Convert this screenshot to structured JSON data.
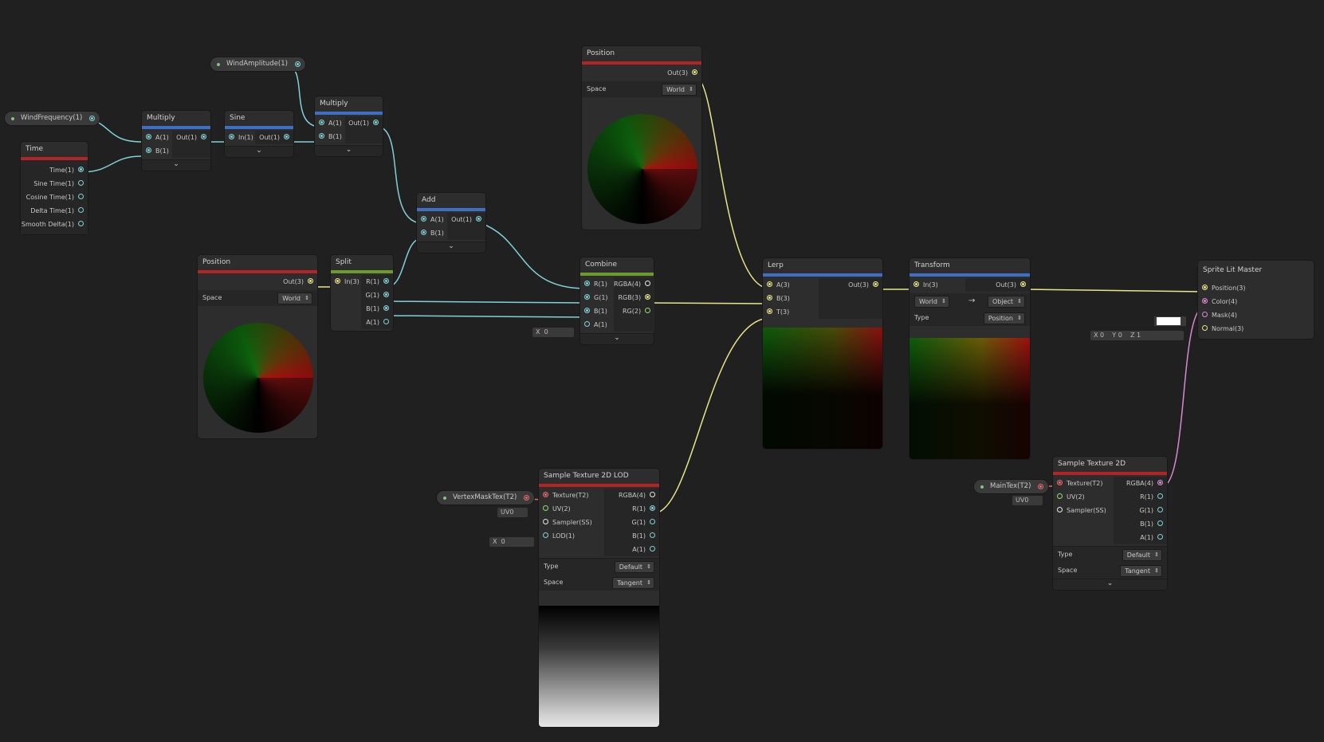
{
  "props": {
    "wind_frequency": "WindFrequency(1)",
    "wind_amplitude": "WindAmplitude(1)",
    "vertex_mask_tex": "VertexMaskTex(T2)",
    "main_tex": "MainTex(T2)"
  },
  "time": {
    "title": "Time",
    "outs": [
      "Time(1)",
      "Sine Time(1)",
      "Cosine Time(1)",
      "Delta Time(1)",
      "Smooth Delta(1)"
    ]
  },
  "multiply1": {
    "title": "Multiply",
    "in_a": "A(1)",
    "in_b": "B(1)",
    "out": "Out(1)"
  },
  "sine": {
    "title": "Sine",
    "in": "In(1)",
    "out": "Out(1)"
  },
  "multiply2": {
    "title": "Multiply",
    "in_a": "A(1)",
    "in_b": "B(1)",
    "out": "Out(1)"
  },
  "add": {
    "title": "Add",
    "in_a": "A(1)",
    "in_b": "B(1)",
    "out": "Out(1)"
  },
  "position_top": {
    "title": "Position",
    "out": "Out(3)",
    "space_label": "Space",
    "space_value": "World"
  },
  "position_left": {
    "title": "Position",
    "out": "Out(3)",
    "space_label": "Space",
    "space_value": "World"
  },
  "split": {
    "title": "Split",
    "in": "In(3)",
    "outs": [
      "R(1)",
      "G(1)",
      "B(1)",
      "A(1)"
    ]
  },
  "combine": {
    "title": "Combine",
    "ins": [
      "R(1)",
      "G(1)",
      "B(1)",
      "A(1)"
    ],
    "outs": [
      "RGBA(4)",
      "RGB(3)",
      "RG(2)"
    ],
    "a_default_label": "X",
    "a_default_value": "0"
  },
  "lerp": {
    "title": "Lerp",
    "ins": [
      "A(3)",
      "B(3)",
      "T(3)"
    ],
    "out": "Out(3)"
  },
  "transform": {
    "title": "Transform",
    "in": "In(3)",
    "out": "Out(3)",
    "from": "World",
    "to": "Object",
    "type_label": "Type",
    "type_value": "Position"
  },
  "master": {
    "title": "Sprite Lit Master",
    "ins": [
      "Position(3)",
      "Color(4)",
      "Mask(4)",
      "Normal(3)"
    ],
    "normal_default": {
      "x_label": "X",
      "x": "0",
      "y_label": "Y",
      "y": "0",
      "z_label": "Z",
      "z": "1"
    }
  },
  "sample_lod": {
    "title": "Sample Texture 2D LOD",
    "ins": [
      "Texture(T2)",
      "UV(2)",
      "Sampler(SS)",
      "LOD(1)"
    ],
    "outs": [
      "RGBA(4)",
      "R(1)",
      "G(1)",
      "B(1)",
      "A(1)"
    ],
    "uv_default": "UV0",
    "lod_label": "X",
    "lod_value": "0",
    "type_label": "Type",
    "type_value": "Default",
    "space_label": "Space",
    "space_value": "Tangent"
  },
  "sample_tex": {
    "title": "Sample Texture 2D",
    "ins": [
      "Texture(T2)",
      "UV(2)",
      "Sampler(SS)"
    ],
    "outs": [
      "RGBA(4)",
      "R(1)",
      "G(1)",
      "B(1)",
      "A(1)"
    ],
    "uv_default": "UV0",
    "type_label": "Type",
    "type_value": "Default",
    "space_label": "Space",
    "space_value": "Tangent"
  },
  "colors": {
    "background": "#202020",
    "wire_float": "#7fd1d6",
    "wire_vec3": "#e8e48a",
    "wire_vec4": "#d889d4",
    "header_red": "#b32424",
    "header_blue": "#3d6fc4",
    "header_green": "#6d9b2c"
  }
}
